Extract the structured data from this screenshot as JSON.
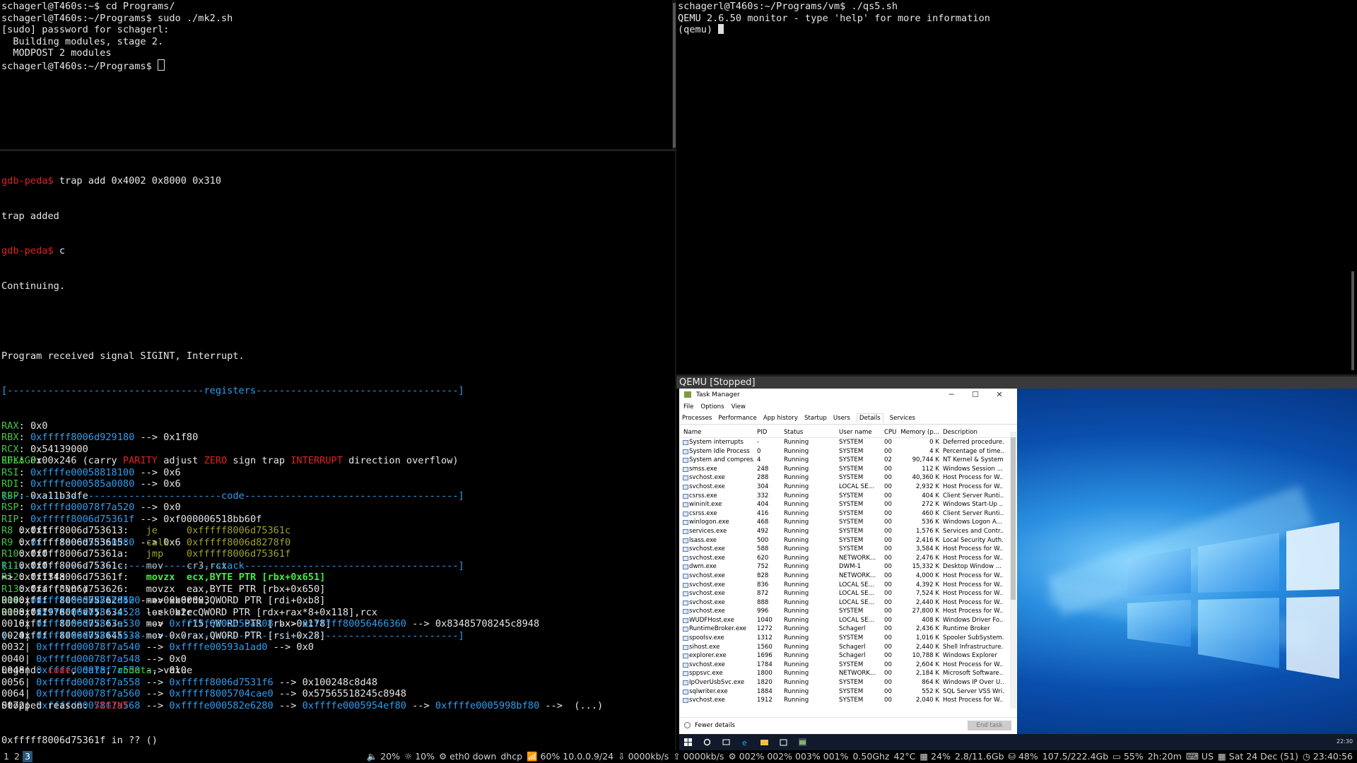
{
  "top_left_terminal": [
    "schagerl@T460s:~$ cd Programs/",
    "schagerl@T460s:~/Programs$ sudo ./mk2.sh",
    "[sudo] password for schagerl:",
    "  Building modules, stage 2.",
    "  MODPOST 2 modules",
    "schagerl@T460s:~/Programs$ "
  ],
  "top_right_terminal": [
    "schagerl@T460s:~/Programs/vm$ ./qs5.sh",
    "QEMU 2.6.50 monitor - type 'help' for more information",
    "(qemu) "
  ],
  "gdb": {
    "prompt": "gdb-peda$",
    "cmd1": " trap add 0x4002 0x8000 0x310",
    "out1": "trap added",
    "cmd2": " c",
    "continuing": "Continuing.",
    "signal_msg": "Program received signal SIGINT, Interrupt.",
    "registers_header": "[----------------------------------registers-----------------------------------]",
    "registers": [
      {
        "name": "RAX",
        "sep": ": ",
        "ptr": "",
        "val": "0x0"
      },
      {
        "name": "RBX",
        "sep": ": ",
        "ptr": "0xfffff8006d929180",
        "val": " --> 0x1f80"
      },
      {
        "name": "RCX",
        "sep": ": ",
        "ptr": "",
        "val": "0x54139000"
      },
      {
        "name": "RDX",
        "sep": ": ",
        "ptr": "",
        "val": "0x0"
      },
      {
        "name": "RSI",
        "sep": ": ",
        "ptr": "0xffffe00058818100",
        "val": " --> 0x6"
      },
      {
        "name": "RDI",
        "sep": ": ",
        "ptr": "0xffffe000585a0080",
        "val": " --> 0x6"
      },
      {
        "name": "RBP",
        "sep": ": ",
        "ptr": "",
        "val": "0xa11b3dfe"
      },
      {
        "name": "RSP",
        "sep": ": ",
        "ptr": "0xffffd00078f7a520",
        "val": " --> 0x0"
      },
      {
        "name": "RIP",
        "sep": ": ",
        "ptr": "0xfffff8006d75361f",
        "val": " --> 0xf000006518bb60f"
      },
      {
        "name": "R8",
        "sep": " : ",
        "ptr": "",
        "val": "0x1"
      },
      {
        "name": "R9",
        "sep": " : ",
        "ptr": "0xffffe000585a0080",
        "val": " --> 0x6"
      },
      {
        "name": "R10",
        "sep": ": ",
        "ptr": "",
        "val": "0x0"
      },
      {
        "name": "R11",
        "sep": ": ",
        "ptr": "",
        "val": "0x0"
      },
      {
        "name": "R12",
        "sep": ": ",
        "ptr": "",
        "val": "0x134a"
      },
      {
        "name": "R13",
        "sep": ": ",
        "ptr": "",
        "val": "0xa ('\\n')"
      },
      {
        "name": "R14",
        "sep": ": ",
        "ptr": "0xffffe000587ac840",
        "val": " --> 0xb60003"
      },
      {
        "name": "R15",
        "sep": ": ",
        "ptr": "",
        "val": "0x2976 ('v')"
      }
    ],
    "eflags_label": "EFLAGS",
    "eflags_val": ": 0x246 (",
    "eflags_flags": [
      {
        "t": "carry ",
        "c": "n"
      },
      {
        "t": "PARITY ",
        "c": "r"
      },
      {
        "t": "adjust ",
        "c": "n"
      },
      {
        "t": "ZERO ",
        "c": "r"
      },
      {
        "t": "sign trap ",
        "c": "n"
      },
      {
        "t": "INTERRUPT ",
        "c": "r"
      },
      {
        "t": "direction overflow",
        "c": "n"
      },
      {
        "t": ")",
        "c": "n"
      }
    ],
    "code_header": "[-------------------------------------code-------------------------------------]",
    "code": [
      {
        "prefix": "   ",
        "addr": "0xfffff8006d753613:",
        "op": "je     0xfffff8006d75361c",
        "cls": "ylw"
      },
      {
        "prefix": "   ",
        "addr": "0xfffff8006d753615:",
        "op": "call   0xfffff8006d8278f0",
        "cls": "ylw"
      },
      {
        "prefix": "   ",
        "addr": "0xfffff8006d75361a:",
        "op": "jmp    0xfffff8006d75361f",
        "cls": "ylw"
      },
      {
        "prefix": "   ",
        "addr": "0xfffff8006d75361c:",
        "op": "mov    cr3,rcx",
        "cls": "gry"
      },
      {
        "prefix": "=> ",
        "addr": "0xfffff8006d75361f:",
        "op": "movzx  ecx,BYTE PTR [rbx+0x651]",
        "cls": "bgrn"
      },
      {
        "prefix": "   ",
        "addr": "0xfffff8006d753626:",
        "op": "movzx  eax,BYTE PTR [rbx+0x650]",
        "cls": "wht"
      },
      {
        "prefix": "   ",
        "addr": "0xfffff8006d75362d:",
        "op": "mov    rdx,QWORD PTR [rdi+0xb8]",
        "cls": "wht"
      },
      {
        "prefix": "   ",
        "addr": "0xfffff8006d753634:",
        "op": "lock btr QWORD PTR [rdx+rax*8+0x118],rcx",
        "cls": "wht"
      },
      {
        "prefix": "   ",
        "addr": "0xfffff8006d75363e:",
        "op": "mov    r15,QWORD PTR [rbx-0x178]",
        "cls": "wht"
      },
      {
        "prefix": "   ",
        "addr": "0xfffff8006d753645:",
        "op": "mov    rax,QWORD PTR [rsi+0x28]",
        "cls": "wht"
      }
    ],
    "stack_header": "[------------------------------------stack-------------------------------------]",
    "stack": [
      [
        {
          "t": "0000| ",
          "c": "w"
        },
        {
          "t": "0xffffd00078f7a520",
          "c": "b"
        },
        {
          "t": " --> 0x0",
          "c": "w"
        }
      ],
      [
        {
          "t": "0008| ",
          "c": "w"
        },
        {
          "t": "0xffffd00078f7a528",
          "c": "b"
        },
        {
          "t": " --> 0x2ec",
          "c": "w"
        }
      ],
      [
        {
          "t": "0016| ",
          "c": "w"
        },
        {
          "t": "0xffffd00078f7a530",
          "c": "b"
        },
        {
          "t": " --> ",
          "c": "w"
        },
        {
          "t": "0xfffff8005658ac08",
          "c": "b"
        },
        {
          "t": " --> ",
          "c": "w"
        },
        {
          "t": "0xfffff80056466360",
          "c": "b"
        },
        {
          "t": " --> 0x83485708245c8948",
          "c": "w"
        }
      ],
      [
        {
          "t": "0024| ",
          "c": "w"
        },
        {
          "t": "0xffffd00078f7a538",
          "c": "b"
        },
        {
          "t": " --> 0x0",
          "c": "w"
        }
      ],
      [
        {
          "t": "0032| ",
          "c": "w"
        },
        {
          "t": "0xffffd00078f7a540",
          "c": "b"
        },
        {
          "t": " --> ",
          "c": "w"
        },
        {
          "t": "0xffffe00593a1ad0",
          "c": "b"
        },
        {
          "t": " --> 0x0",
          "c": "w"
        }
      ],
      [
        {
          "t": "0040| ",
          "c": "w"
        },
        {
          "t": "0xffffd00078f7a548",
          "c": "b"
        },
        {
          "t": " --> 0x0",
          "c": "w"
        }
      ],
      [
        {
          "t": "0048| ",
          "c": "w"
        },
        {
          "t": "0xffffd00078f7a550",
          "c": "b"
        },
        {
          "t": " --> 0x0",
          "c": "w"
        }
      ],
      [
        {
          "t": "0056| ",
          "c": "w"
        },
        {
          "t": "0xffffd00078f7a558",
          "c": "b"
        },
        {
          "t": " --> ",
          "c": "w"
        },
        {
          "t": "0xfffff8006d7531f6",
          "c": "b"
        },
        {
          "t": " --> 0x100248c8d48",
          "c": "w"
        }
      ],
      [
        {
          "t": "0064| ",
          "c": "w"
        },
        {
          "t": "0xffffd00078f7a560",
          "c": "b"
        },
        {
          "t": " --> ",
          "c": "w"
        },
        {
          "t": "0xfffff8005704cae0",
          "c": "b"
        },
        {
          "t": " --> 0x57565518245c8948",
          "c": "w"
        }
      ],
      [
        {
          "t": "0072| ",
          "c": "w"
        },
        {
          "t": "0xffffd00078f7a568",
          "c": "b"
        },
        {
          "t": " --> ",
          "c": "w"
        },
        {
          "t": "0xffffe000582e6280",
          "c": "b"
        },
        {
          "t": " --> ",
          "c": "w"
        },
        {
          "t": "0xffffe0005954ef80",
          "c": "b"
        },
        {
          "t": " --> ",
          "c": "w"
        },
        {
          "t": "0xffffe0005998bf80",
          "c": "b"
        },
        {
          "t": " -->  (...)",
          "c": "w"
        }
      ]
    ],
    "footer_sep": "[------------------------------------------------------------------------------]",
    "legend_label": "Legend: ",
    "legend_code": "code",
    "legend_data": "data",
    "legend_rodata": "rodata",
    "legend_value": "value",
    "legend_comma": ", ",
    "stopped_label": "Stopped reason: ",
    "stopped_reason": "SIGINT",
    "last_line": "0xfffff8006d75361f in ?? ()"
  },
  "qemu_title": "QEMU [Stopped]",
  "task_manager": {
    "title": "Task Manager",
    "win_min": "─",
    "win_max": "☐",
    "win_close": "✕",
    "menu": [
      "File",
      "Options",
      "View"
    ],
    "tabs": [
      "Processes",
      "Performance",
      "App history",
      "Startup",
      "Users",
      "Details",
      "Services"
    ],
    "active_tab": "Details",
    "columns": [
      "Name",
      "PID",
      "Status",
      "User name",
      "CPU",
      "Memory (p...",
      "Description"
    ],
    "rows": [
      [
        "System interrupts",
        "-",
        "Running",
        "SYSTEM",
        "00",
        "0 K",
        "Deferred procedure..."
      ],
      [
        "System Idle Process",
        "0",
        "Running",
        "SYSTEM",
        "00",
        "4 K",
        "Percentage of time..."
      ],
      [
        "System and compres...",
        "4",
        "Running",
        "SYSTEM",
        "02",
        "90,744 K",
        "NT Kernel & System"
      ],
      [
        "smss.exe",
        "248",
        "Running",
        "SYSTEM",
        "00",
        "112 K",
        "Windows Session ..."
      ],
      [
        "svchost.exe",
        "288",
        "Running",
        "SYSTEM",
        "00",
        "40,360 K",
        "Host Process for W..."
      ],
      [
        "svchost.exe",
        "304",
        "Running",
        "LOCAL SE...",
        "00",
        "2,932 K",
        "Host Process for W..."
      ],
      [
        "csrss.exe",
        "332",
        "Running",
        "SYSTEM",
        "00",
        "404 K",
        "Client Server Runti..."
      ],
      [
        "wininit.exe",
        "404",
        "Running",
        "SYSTEM",
        "00",
        "272 K",
        "Windows Start-Up ..."
      ],
      [
        "csrss.exe",
        "416",
        "Running",
        "SYSTEM",
        "00",
        "460 K",
        "Client Server Runti..."
      ],
      [
        "winlogon.exe",
        "468",
        "Running",
        "SYSTEM",
        "00",
        "536 K",
        "Windows Logon A..."
      ],
      [
        "services.exe",
        "492",
        "Running",
        "SYSTEM",
        "00",
        "1,576 K",
        "Services and Contr..."
      ],
      [
        "lsass.exe",
        "500",
        "Running",
        "SYSTEM",
        "00",
        "2,416 K",
        "Local Security Auth..."
      ],
      [
        "svchost.exe",
        "588",
        "Running",
        "SYSTEM",
        "00",
        "3,584 K",
        "Host Process for W..."
      ],
      [
        "svchost.exe",
        "620",
        "Running",
        "NETWORK...",
        "00",
        "2,476 K",
        "Host Process for W..."
      ],
      [
        "dwm.exe",
        "752",
        "Running",
        "DWM-1",
        "00",
        "15,332 K",
        "Desktop Window ..."
      ],
      [
        "svchost.exe",
        "828",
        "Running",
        "NETWORK...",
        "00",
        "4,000 K",
        "Host Process for W..."
      ],
      [
        "svchost.exe",
        "836",
        "Running",
        "LOCAL SE...",
        "00",
        "4,392 K",
        "Host Process for W..."
      ],
      [
        "svchost.exe",
        "872",
        "Running",
        "LOCAL SE...",
        "00",
        "7,524 K",
        "Host Process for W..."
      ],
      [
        "svchost.exe",
        "888",
        "Running",
        "LOCAL SE...",
        "00",
        "2,440 K",
        "Host Process for W..."
      ],
      [
        "svchost.exe",
        "996",
        "Running",
        "SYSTEM",
        "00",
        "27,800 K",
        "Host Process for W..."
      ],
      [
        "WUDFHost.exe",
        "1040",
        "Running",
        "LOCAL SE...",
        "00",
        "408 K",
        "Windows Driver Fo..."
      ],
      [
        "RuntimeBroker.exe",
        "1272",
        "Running",
        "Schagerl",
        "00",
        "2,436 K",
        "Runtime Broker"
      ],
      [
        "spoolsv.exe",
        "1312",
        "Running",
        "SYSTEM",
        "00",
        "1,016 K",
        "Spooler SubSystem..."
      ],
      [
        "sihost.exe",
        "1560",
        "Running",
        "Schagerl",
        "00",
        "2,440 K",
        "Shell Infrastructure..."
      ],
      [
        "explorer.exe",
        "1696",
        "Running",
        "Schagerl",
        "00",
        "10,788 K",
        "Windows Explorer"
      ],
      [
        "svchost.exe",
        "1784",
        "Running",
        "SYSTEM",
        "00",
        "2,604 K",
        "Host Process for W..."
      ],
      [
        "sppsvc.exe",
        "1800",
        "Running",
        "NETWORK...",
        "00",
        "2,184 K",
        "Microsoft Software..."
      ],
      [
        "IpOverUsbSvc.exe",
        "1820",
        "Running",
        "SYSTEM",
        "00",
        "864 K",
        "Windows IP Over U..."
      ],
      [
        "sqlwriter.exe",
        "1884",
        "Running",
        "SYSTEM",
        "00",
        "552 K",
        "SQL Server VSS Wri..."
      ],
      [
        "svchost.exe",
        "1912",
        "Running",
        "SYSTEM",
        "00",
        "2,040 K",
        "Host Process for W..."
      ]
    ],
    "fewer_details": "Fewer details",
    "end_task": "End task"
  },
  "win_taskbar": {
    "clock": "22:30"
  },
  "i3bar": {
    "workspaces": [
      "1",
      "2",
      "3"
    ],
    "active_workspace": "3",
    "status": [
      "🔈 20%",
      "☼ 10%",
      "⚙ eth0 down",
      "dhcp",
      "📶 60% 10.0.0.9/24",
      "⇩ 0000kb/s",
      "⇧ 0000kb/s",
      "⚙ 002% 002% 003% 001%",
      "0.50Ghz",
      "42°C",
      "▦ 24%",
      "2.8/11.6Gb",
      "⛁ 48%",
      "107.5/222.4Gb",
      "▭ 55%",
      "2h:20m",
      "⌨ US",
      "▦ Sat 24 Dec (51)",
      "◷ 23:40:56"
    ]
  },
  "colors": {
    "register_name": "#3ec83e",
    "pointer": "#2f9df0",
    "flag_set": "#e02020",
    "prompt": "#e02020",
    "active_workspace": "#285577"
  }
}
